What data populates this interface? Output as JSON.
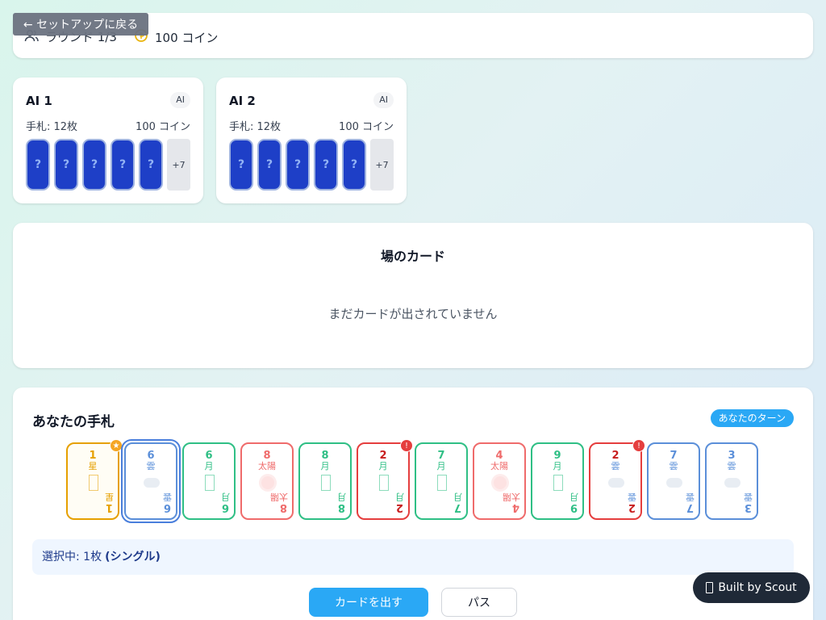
{
  "header": {
    "back_label": "← セットアップに戻る",
    "round_label": "ラウンド 1/3",
    "coins_label": "100 コイン"
  },
  "opponents": [
    {
      "name": "AI 1",
      "badge": "AI",
      "hand_label": "手札: 12枚",
      "coins_label": "100 コイン",
      "back_symbol": "?",
      "more_label": "+7"
    },
    {
      "name": "AI 2",
      "badge": "AI",
      "hand_label": "手札: 12枚",
      "coins_label": "100 コイン",
      "back_symbol": "?",
      "more_label": "+7"
    }
  ],
  "field": {
    "title": "場のカード",
    "empty_text": "まだカードが出されていません"
  },
  "hand": {
    "title": "あなたの手札",
    "turn_badge": "あなたのターン",
    "cards": [
      {
        "number": "1",
        "suit": "星",
        "color": "#e6a000",
        "icon": "star-icon",
        "marker": "star"
      },
      {
        "number": "6",
        "suit": "雲",
        "color": "#5b8fd9",
        "icon": "cloud-icon",
        "selected": true
      },
      {
        "number": "6",
        "suit": "月",
        "color": "#2fbf85",
        "icon": "moon-icon"
      },
      {
        "number": "8",
        "suit": "太陽",
        "color": "#ef6b6b",
        "icon": "sun-icon"
      },
      {
        "number": "8",
        "suit": "月",
        "color": "#2fbf85",
        "icon": "moon-icon"
      },
      {
        "number": "2",
        "suit": "月",
        "color": "#2fbf85",
        "icon": "moon-icon",
        "marker": "warning"
      },
      {
        "number": "7",
        "suit": "月",
        "color": "#2fbf85",
        "icon": "moon-icon"
      },
      {
        "number": "4",
        "suit": "太陽",
        "color": "#ef6b6b",
        "icon": "sun-icon"
      },
      {
        "number": "9",
        "suit": "月",
        "color": "#2fbf85",
        "icon": "moon-icon"
      },
      {
        "number": "2",
        "suit": "雲",
        "color": "#5b8fd9",
        "icon": "cloud-icon",
        "marker": "warning"
      },
      {
        "number": "7",
        "suit": "雲",
        "color": "#5b8fd9",
        "icon": "cloud-icon"
      },
      {
        "number": "3",
        "suit": "雲",
        "color": "#5b8fd9",
        "icon": "cloud-icon"
      }
    ],
    "selection_label": "選択中: 1枚",
    "selection_type": "(シングル)",
    "play_button": "カードを出す",
    "pass_button": "パス"
  },
  "colors": {
    "accent": "#2aa8f5",
    "warning": "#e53e3e",
    "star_marker": "#f5a623",
    "card_back": "#1e3fc7"
  },
  "footer": {
    "scout_label": "Built by Scout"
  }
}
